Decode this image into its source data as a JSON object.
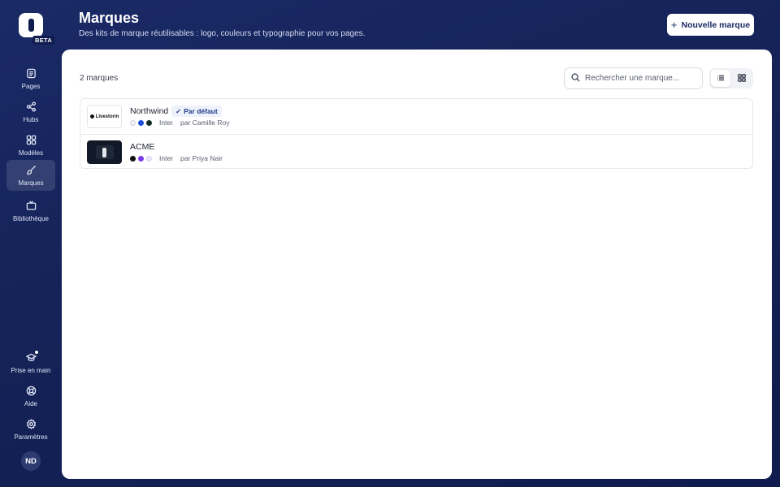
{
  "sidebar": {
    "beta_label": "BETA",
    "items": [
      {
        "label": "Pages",
        "icon": "pages-icon"
      },
      {
        "label": "Hubs",
        "icon": "share-icon"
      },
      {
        "label": "Modèles",
        "icon": "grid-icon"
      },
      {
        "label": "Marques",
        "icon": "brush-icon",
        "active": true
      },
      {
        "label": "Bibliothèque",
        "icon": "tv-icon"
      }
    ],
    "bottom_items": [
      {
        "label": "Prise en main",
        "icon": "graduation-cap-icon"
      },
      {
        "label": "Aide",
        "icon": "lifebuoy-icon"
      },
      {
        "label": "Paramètres",
        "icon": "gear-icon"
      }
    ],
    "avatar_initials": "ND"
  },
  "header": {
    "title": "Marques",
    "subtitle": "Des kits de marque réutilisables : logo, couleurs et typographie pour vos pages.",
    "new_button_label": "Nouvelle marque"
  },
  "main": {
    "count_label": "2 marques",
    "search_placeholder": "Rechercher une marque...",
    "view_mode": "list"
  },
  "brands": [
    {
      "name": "Northwind",
      "default_badge": "Par défaut",
      "logo_text": "Livestorm",
      "colors": [
        "#f3f4f6",
        "#1d4ed8",
        "#0f2d24"
      ],
      "font": "Inter",
      "author": "par Camille Roy"
    },
    {
      "name": "ACME",
      "default_badge": "",
      "logo_text": "",
      "colors": [
        "#111111",
        "#7c3aed",
        "#e8e6f8"
      ],
      "font": "Inter",
      "author": "par Priya Nair"
    }
  ]
}
